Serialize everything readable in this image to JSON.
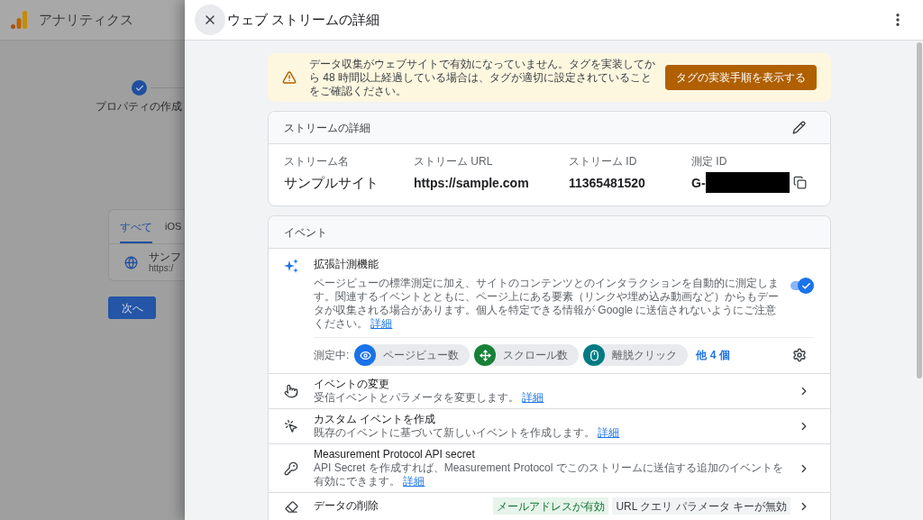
{
  "background_page": {
    "app_title": "アナリティクス",
    "step": {
      "label": "プロパティの作成",
      "done": true
    },
    "tabs": [
      {
        "label": "すべて",
        "selected": true
      },
      {
        "label": "iOS",
        "selected": false
      }
    ],
    "stream_item": {
      "name": "サンフ",
      "url": "https:/"
    },
    "next_button": "次へ"
  },
  "panel": {
    "title": "ウェブ ストリームの詳細"
  },
  "banner": {
    "message": "データ収集がウェブサイトで有効になっていません。タグを実装してから 48 時間以上経過している場合は、タグが適切に設定されていることをご確認ください。",
    "button": "タグの実装手順を表示する"
  },
  "stream_details": {
    "title": "ストリームの詳細",
    "fields": [
      {
        "label": "ストリーム名",
        "value": "サンプルサイト",
        "kind": "text"
      },
      {
        "label": "ストリーム URL",
        "value": "https://sample.com",
        "kind": "bold"
      },
      {
        "label": "ストリーム ID",
        "value": "11365481520",
        "kind": "bold"
      },
      {
        "label": "測定 ID",
        "value": "G-",
        "kind": "redacted"
      }
    ]
  },
  "events": {
    "title": "イベント",
    "enhanced": {
      "title": "拡張計測機能",
      "description": "ページビューの標準測定に加え、サイトのコンテンツとのインタラクションを自動的に測定します。関連するイベントとともに、ページ上にある要素（リンクや埋め込み動画など）からもデータが収集される場合があります。個人を特定できる情報が Google に送信されないようにご注意ください。",
      "link": "詳細",
      "on": true,
      "measuring_label": "測定中:",
      "chips": [
        {
          "label": "ページビュー数",
          "color": "#1a73e8"
        },
        {
          "label": "スクロール数",
          "color": "#188038"
        },
        {
          "label": "離脱クリック",
          "color": "#007b83"
        }
      ],
      "more_link": "他 4 個"
    },
    "rows": [
      {
        "kind": "detail",
        "title": "イベントの変更",
        "subtitle": "受信イベントとパラメータを変更します。",
        "link": "詳細"
      },
      {
        "kind": "detail",
        "title": "カスタム イベントを作成",
        "subtitle": "既存のイベントに基づいて新しいイベントを作成します。",
        "link": "詳細"
      },
      {
        "kind": "detail",
        "title": "Measurement Protocol API secret",
        "subtitle": "API Secret を作成すれば、Measurement Protocol でこのストリームに送信する追加のイベントを有効にできます。",
        "link": "詳細"
      },
      {
        "kind": "badges",
        "title": "データの削除",
        "badges": [
          {
            "label": "メールアドレスが有効",
            "on": true
          },
          {
            "label": "URL クエリ パラメータ キーが無効",
            "on": false
          }
        ]
      }
    ]
  }
}
